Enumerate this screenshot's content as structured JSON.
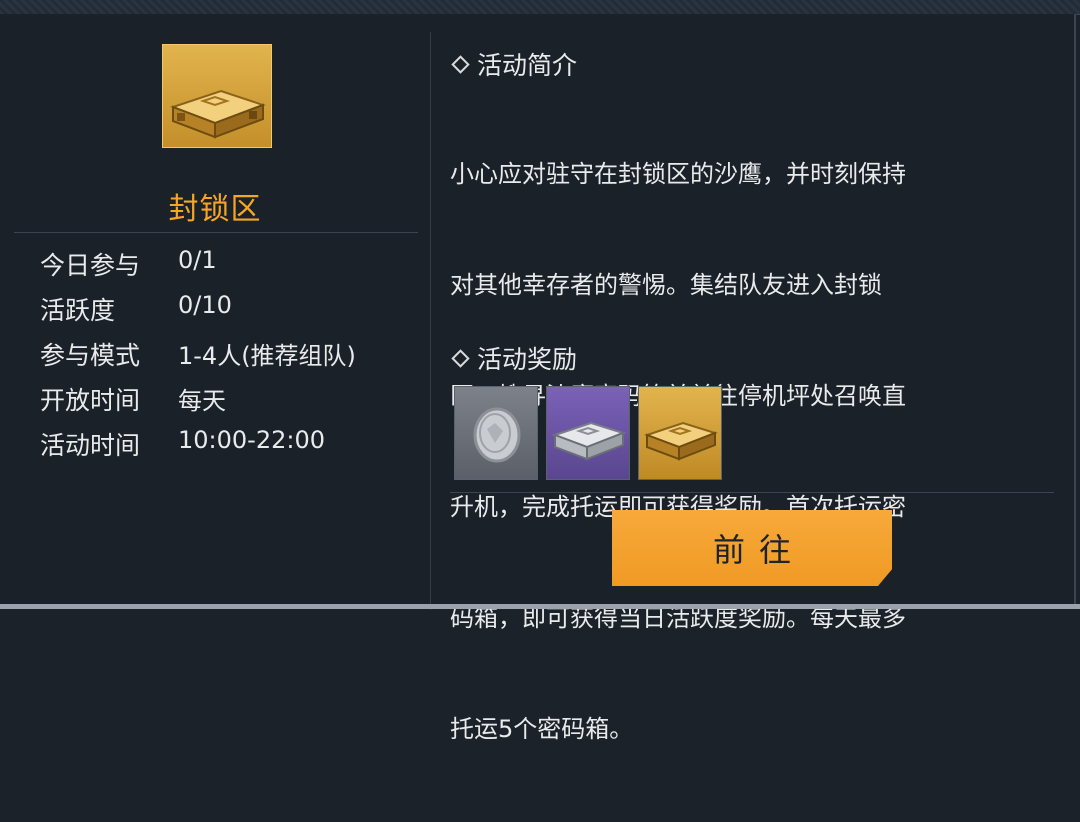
{
  "item": {
    "title": "封锁区",
    "icon": "gold-supply-crate-icon"
  },
  "info": [
    {
      "label": "今日参与",
      "value": "0/1"
    },
    {
      "label": "活跃度",
      "value": "0/10"
    },
    {
      "label": "参与模式",
      "value": "1-4人(推荐组队)"
    },
    {
      "label": "开放时间",
      "value": "每天"
    },
    {
      "label": "活动时间",
      "value": "10:00-22:00"
    }
  ],
  "intro": {
    "heading": "活动简介",
    "lines": [
      "小心应对驻守在封锁区的沙鹰，并时刻保持",
      "对其他幸存者的警惕。集结队友进入封锁",
      "区，搜寻沙鹰密码箱并前往停机坪处召唤直",
      "升机，完成托运即可获得奖励。首次托运密",
      "码箱，即可获得当日活跃度奖励。每天最多",
      "托运5个密码箱。"
    ]
  },
  "rewards": {
    "heading": "活动奖励",
    "items": [
      {
        "icon": "silver-coin-icon",
        "rarity_color": "#6b7078"
      },
      {
        "icon": "silver-crate-icon",
        "rarity_color": "#6a54a6"
      },
      {
        "icon": "gold-crate-icon",
        "rarity_color": "#d4a23c"
      }
    ]
  },
  "go_button": {
    "label": "前往"
  },
  "colors": {
    "accent": "#f5a623",
    "button": "#f3a030",
    "background": "#1b2128"
  }
}
